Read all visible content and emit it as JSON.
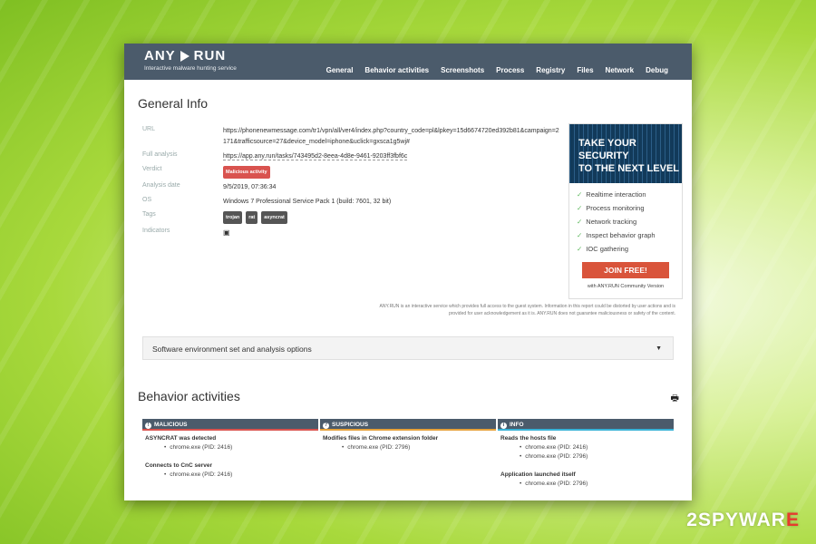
{
  "header": {
    "logo_text_a": "ANY",
    "logo_text_b": "RUN",
    "tagline": "Interactive malware hunting service",
    "nav": [
      "General",
      "Behavior activities",
      "Screenshots",
      "Process",
      "Registry",
      "Files",
      "Network",
      "Debug"
    ]
  },
  "general": {
    "title": "General Info",
    "url_label": "URL",
    "url_value": "https://phonenewmessage.com/tr1/vpn/all/ver4/index.php?country_code=pl&lpkey=15d6674720ed392b81&campaign=2171&trafficsource=27&device_model=iphone&uclick=gxsca1g5wj#",
    "full_label": "Full analysis",
    "full_value": "https://app.any.run/tasks/743495d2-8eea-4d8e-9461-9203ff3fbf6c",
    "verdict_label": "Verdict",
    "verdict_value": "Malicious activity",
    "date_label": "Analysis date",
    "date_value": "9/5/2019, 07:36:34",
    "os_label": "OS",
    "os_value": "Windows 7 Professional Service Pack 1 (build: 7601, 32 bit)",
    "tags_label": "Tags",
    "tags": [
      "trojan",
      "rat",
      "asyncrat"
    ],
    "indicators_label": "Indicators"
  },
  "promo": {
    "head_line1": "TAKE YOUR SECURITY",
    "head_line2": "TO THE NEXT LEVEL",
    "features": [
      "Realtime interaction",
      "Process monitoring",
      "Network tracking",
      "Inspect behavior graph",
      "IOC gathering"
    ],
    "join_label": "JOIN FREE!",
    "footer": "with ANY.RUN Community Version"
  },
  "disclaimer": "ANY.RUN is an interactive service which provides full access to the guest system. Information in this report could be distorted by user actions and is provided for user acknowledgement as it is. ANY.RUN does not guarantee maliciousness or safety of the content.",
  "accordion": {
    "label": "Software environment set and analysis options"
  },
  "behavior": {
    "title": "Behavior activities",
    "malicious": {
      "head": "MALICIOUS",
      "t1": "ASYNCRAT was detected",
      "s1": "chrome.exe (PID: 2416)",
      "t2": "Connects to CnC server",
      "s2": "chrome.exe (PID: 2416)"
    },
    "suspicious": {
      "head": "SUSPICIOUS",
      "t1": "Modifies files in Chrome extension folder",
      "s1": "chrome.exe (PID: 2796)"
    },
    "info": {
      "head": "INFO",
      "t1": "Reads the hosts file",
      "s1": "chrome.exe (PID: 2416)",
      "s2": "chrome.exe (PID: 2796)",
      "t2": "Application launched itself",
      "s3": "chrome.exe (PID: 2796)"
    }
  },
  "watermark": {
    "a": "2SPYWAR",
    "b": "E"
  },
  "colors": {
    "topbar": "#4b5b6b",
    "malicious": "#d9534f",
    "suspicious": "#e6a23c",
    "info": "#39b3d7",
    "join": "#d9543b"
  }
}
